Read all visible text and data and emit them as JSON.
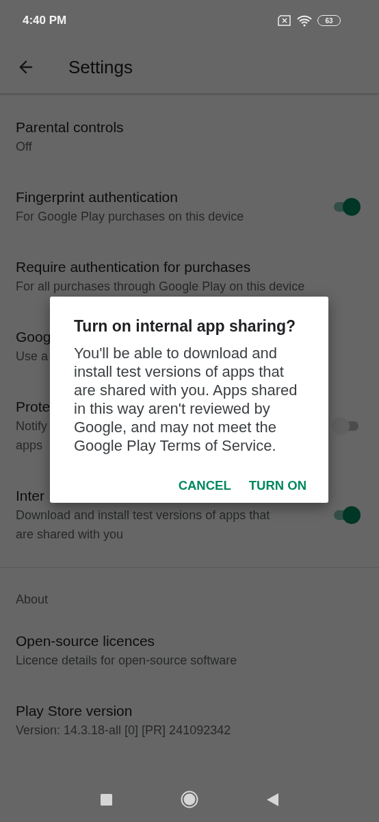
{
  "status_bar": {
    "time": "4:40 PM",
    "battery": "63"
  },
  "toolbar": {
    "title": "Settings"
  },
  "sections": [
    {
      "items": [
        {
          "kind": "plain",
          "title": "Parental controls",
          "subtitle_lines": [
            "Off"
          ]
        },
        {
          "kind": "toggle",
          "title": "Fingerprint authentication",
          "subtitle_lines": [
            "For Google Play purchases on this device"
          ],
          "on": true
        },
        {
          "kind": "plain",
          "title": "Require authentication for purchases",
          "subtitle_lines": [
            "For all purchases through Google Play on this device"
          ]
        },
        {
          "kind": "plain",
          "title": "Goog",
          "subtitle_lines": [
            "Use a"
          ]
        },
        {
          "kind": "toggle",
          "title": "Prote",
          "subtitle_lines": [
            "Notify",
            "apps"
          ],
          "on": false
        },
        {
          "kind": "toggle",
          "title": "Inter",
          "subtitle_lines": [
            "Download and install test versions of apps that",
            "are shared with you"
          ],
          "on": true
        }
      ]
    },
    {
      "header": "About",
      "items": [
        {
          "kind": "plain",
          "title": "Open-source licences",
          "subtitle_lines": [
            "Licence details for open-source software"
          ]
        },
        {
          "kind": "plain",
          "title": "Play Store version",
          "subtitle_lines": [
            "Version: 14.3.18-all [0] [PR] 241092342"
          ]
        }
      ]
    }
  ],
  "dialog": {
    "title": "Turn on internal app sharing?",
    "body": "You'll be able to download and install test versions of apps that are shared with you. Apps shared in this way aren't reviewed by Google, and may not meet the Google Play Terms of Service.",
    "buttons": [
      "CANCEL",
      "TURN ON"
    ]
  }
}
